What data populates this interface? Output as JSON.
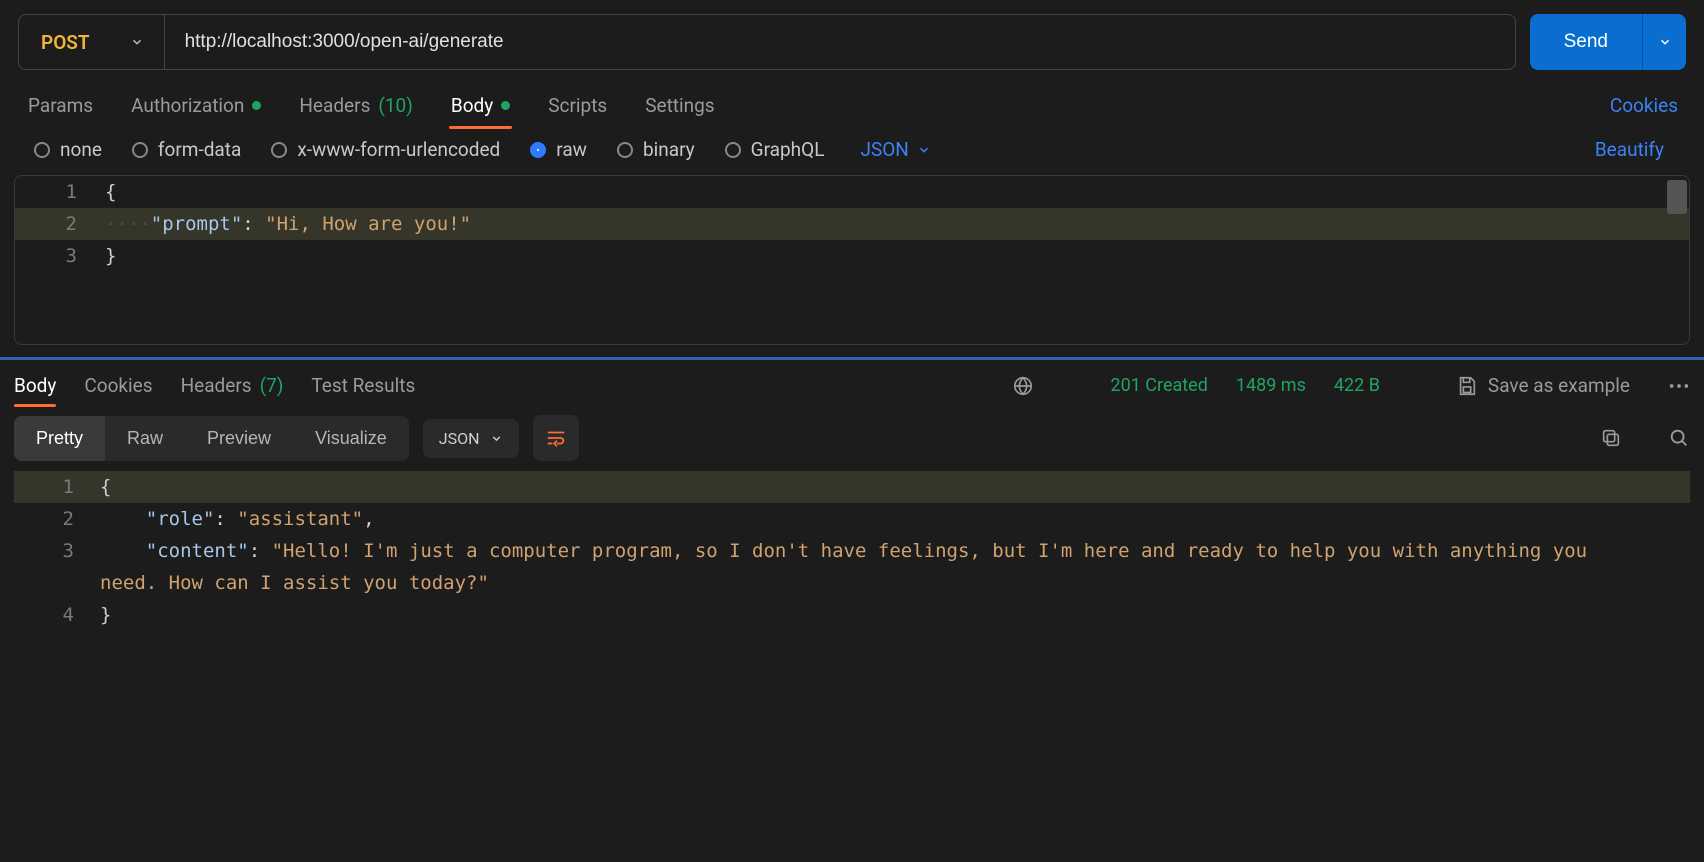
{
  "request": {
    "method": "POST",
    "url": "http://localhost:3000/open-ai/generate",
    "send_label": "Send"
  },
  "tabs": {
    "params": "Params",
    "authorization": "Authorization",
    "headers_label": "Headers",
    "headers_count": "(10)",
    "body": "Body",
    "scripts": "Scripts",
    "settings": "Settings",
    "cookies": "Cookies"
  },
  "body_types": {
    "none": "none",
    "form_data": "form-data",
    "urlencoded": "x-www-form-urlencoded",
    "raw": "raw",
    "binary": "binary",
    "graphql": "GraphQL",
    "lang": "JSON",
    "beautify": "Beautify"
  },
  "req_body": {
    "l1_num": "1",
    "l1": "{",
    "l2_num": "2",
    "l2_key": "\"prompt\"",
    "l2_sep": ": ",
    "l2_val": "\"Hi, How are you!\"",
    "l3_num": "3",
    "l3": "}"
  },
  "resp_tabs": {
    "body": "Body",
    "cookies": "Cookies",
    "headers_label": "Headers",
    "headers_count": "(7)",
    "test_results": "Test Results"
  },
  "resp_meta": {
    "status": "201 Created",
    "time": "1489 ms",
    "size": "422 B",
    "save": "Save as example"
  },
  "view": {
    "pretty": "Pretty",
    "raw": "Raw",
    "preview": "Preview",
    "visualize": "Visualize",
    "lang": "JSON"
  },
  "resp_body": {
    "l1_num": "1",
    "l1": "{",
    "l2_num": "2",
    "l2_key": "\"role\"",
    "l2_sep": ": ",
    "l2_val": "\"assistant\"",
    "l2_tail": ",",
    "l3_num": "3",
    "l3_key": "\"content\"",
    "l3_sep": ": ",
    "l3_val": "\"Hello! I'm just a computer program, so I don't have feelings, but I'm here and ready to help you with anything you need. How can I assist you today?\"",
    "l4_num": "4",
    "l4": "}"
  }
}
